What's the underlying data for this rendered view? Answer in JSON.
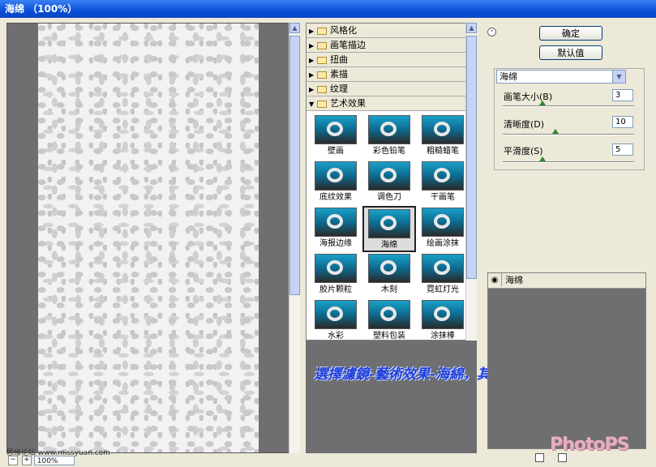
{
  "window": {
    "title": "海绵 （100%）"
  },
  "preview": {
    "zoom": "100%",
    "credit": "思缘论坛  www.missyuan.com"
  },
  "gallery": {
    "categories": [
      {
        "label": "风格化",
        "expanded": false
      },
      {
        "label": "画笔描边",
        "expanded": false
      },
      {
        "label": "扭曲",
        "expanded": false
      },
      {
        "label": "素描",
        "expanded": false
      },
      {
        "label": "纹理",
        "expanded": false
      },
      {
        "label": "艺术效果",
        "expanded": true
      }
    ],
    "filters": [
      "壁画",
      "彩色铅笔",
      "粗糙蜡笔",
      "底纹效果",
      "调色刀",
      "干画笔",
      "海报边缘",
      "海绵",
      "绘画涂抹",
      "胶片颗粒",
      "木刻",
      "霓虹灯光",
      "水彩",
      "塑料包装",
      "涂抹棒"
    ],
    "selected": "海绵"
  },
  "buttons": {
    "ok": "确定",
    "default": "默认值"
  },
  "settings": {
    "filter_select": "海绵",
    "params": [
      {
        "label": "画笔大小(B)",
        "value": "3",
        "slider": 0.3
      },
      {
        "label": "清晰度(D)",
        "value": "10",
        "slider": 0.4
      },
      {
        "label": "平滑度(S)",
        "value": "5",
        "slider": 0.3
      }
    ]
  },
  "layers": {
    "items": [
      {
        "name": "海绵",
        "visible": true
      }
    ]
  },
  "caption": "選擇濾鏡-藝術效果-海綿，其數值自己定",
  "watermark": "PhotoPS"
}
